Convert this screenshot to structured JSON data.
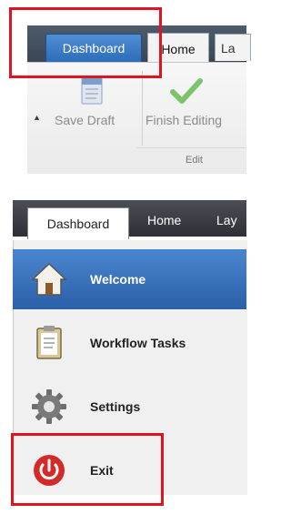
{
  "ribbon": {
    "tabs": [
      "Dashboard",
      "Home",
      "La"
    ],
    "save_draft_label": "Save Draft",
    "finish_editing_label": "Finish Editing",
    "group_label": "Edit",
    "save_draft_icon": "save-draft-icon",
    "finish_editing_icon": "checkmark-icon"
  },
  "nav": {
    "tabs": [
      "Dashboard",
      "Home",
      "Lay"
    ],
    "items": [
      {
        "label": "Welcome",
        "icon": "home-icon",
        "active": true
      },
      {
        "label": "Workflow Tasks",
        "icon": "clipboard-icon",
        "active": false
      },
      {
        "label": "Settings",
        "icon": "gear-icon",
        "active": false
      },
      {
        "label": "Exit",
        "icon": "power-icon",
        "active": false
      }
    ]
  },
  "colors": {
    "highlight": "#e0141e",
    "active_tab": "#2d6cb8",
    "active_item": "#3a74bf"
  }
}
